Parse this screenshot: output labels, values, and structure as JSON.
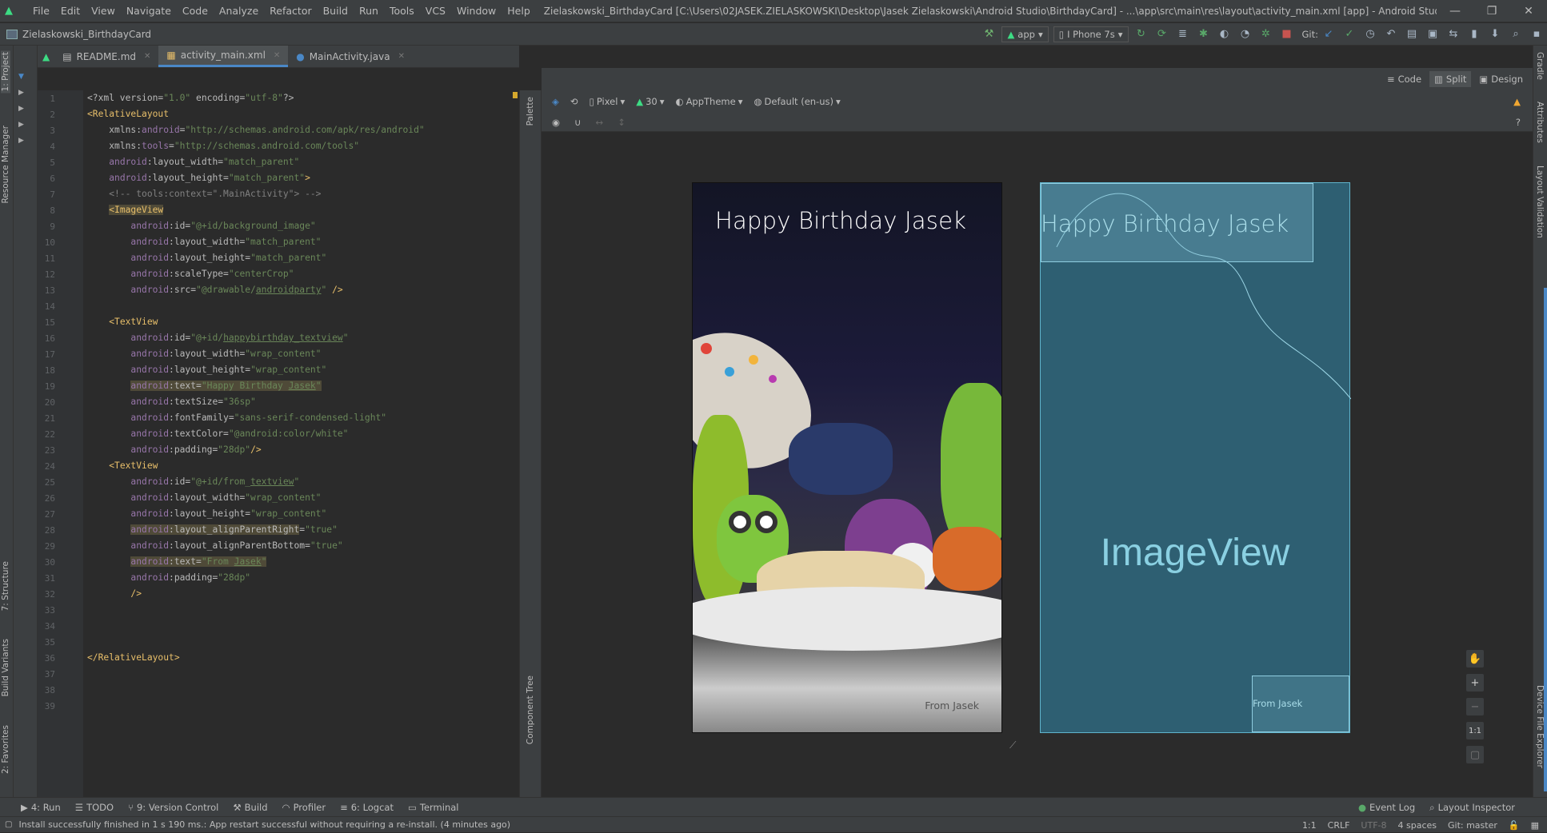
{
  "menubar": {
    "items": [
      "File",
      "Edit",
      "View",
      "Navigate",
      "Code",
      "Analyze",
      "Refactor",
      "Build",
      "Run",
      "Tools",
      "VCS",
      "Window",
      "Help"
    ],
    "window_title": "Zielaskowski_BirthdayCard [C:\\Users\\02JASEK.ZIELASKOWSKI\\Desktop\\Jasek Zielaskowski\\Android Studio\\BirthdayCard] - ...\\app\\src\\main\\res\\layout\\activity_main.xml [app] - Android Studio"
  },
  "navbar": {
    "project_name": "Zielaskowski_BirthdayCard",
    "run_config": "app",
    "device": "I Phone 7s",
    "git_label": "Git:"
  },
  "editor_tabs": [
    {
      "label": "README.md"
    },
    {
      "label": "activity_main.xml"
    },
    {
      "label": "MainActivity.java"
    }
  ],
  "line_numbers": [
    "1",
    "2",
    "3",
    "4",
    "5",
    "6",
    "7",
    "8",
    "9",
    "10",
    "11",
    "12",
    "13",
    "14",
    "15",
    "16",
    "17",
    "18",
    "19",
    "20",
    "21",
    "22",
    "23",
    "24",
    "25",
    "26",
    "27",
    "28",
    "29",
    "30",
    "31",
    "32",
    "33",
    "34",
    "35",
    "36",
    "37",
    "38",
    "39"
  ],
  "left_stripe": {
    "project": "1: Project",
    "resource": "Resource Manager",
    "structure": "7: Structure",
    "build_variants": "Build Variants",
    "favorites": "2: Favorites"
  },
  "right_stripe": {
    "gradle": "Gradle",
    "attributes": "Attributes",
    "layout_validation": "Layout Validation",
    "device_file_explorer": "Device File Explorer"
  },
  "palette_strip": {
    "palette": "Palette",
    "component_tree": "Component Tree"
  },
  "design_modes": {
    "code": "Code",
    "split": "Split",
    "design": "Design"
  },
  "design_toolbar": {
    "device": "Pixel",
    "api": "30",
    "theme": "AppTheme",
    "locale": "Default (en-us)"
  },
  "preview": {
    "title_text": "Happy Birthday Jasek",
    "from_text": "From Jasek",
    "imageview_label": "ImageView"
  },
  "zoom": {
    "plus": "+",
    "minus": "−",
    "one_to_one": "1:1"
  },
  "bottom_tools": {
    "run": "4: Run",
    "todo": "TODO",
    "vcs": "9: Version Control",
    "build": "Build",
    "profiler": "Profiler",
    "logcat": "6: Logcat",
    "terminal": "Terminal",
    "event_log": "Event Log",
    "layout_inspector": "Layout Inspector"
  },
  "status": {
    "message": "Install successfully finished in 1 s 190 ms.: App restart successful without requiring a re-install. (4 minutes ago)",
    "position": "1:1",
    "line_sep": "CRLF",
    "encoding": "UTF-8",
    "indent": "4 spaces",
    "branch": "Git: master"
  },
  "colors": {
    "accent": "#4a88c7",
    "blueprint": "#2e5f72",
    "android_green": "#3ddc84"
  }
}
